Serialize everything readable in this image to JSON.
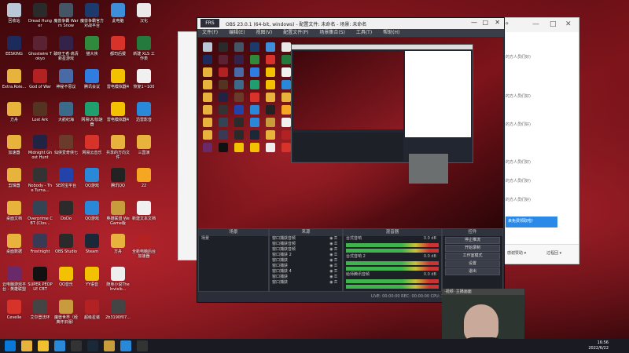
{
  "desktop_icons": [
    {
      "label": "回收站",
      "color": "#b9c7d6",
      "col": 0,
      "row": 0
    },
    {
      "label": "Dread Hunger",
      "color": "#2a2a2a",
      "col": 1,
      "row": 0
    },
    {
      "label": "魔兽争霸 Warm Snow",
      "color": "#445566",
      "col": 2,
      "row": 0
    },
    {
      "label": "魔兽争霸官方对战平台",
      "color": "#1c3a6b",
      "col": 3,
      "row": 0
    },
    {
      "label": "此电脑",
      "color": "#3c8fd8",
      "col": 4,
      "row": 0
    },
    {
      "label": "汉化",
      "color": "#eaeaea",
      "col": 5,
      "row": 0
    },
    {
      "label": "EESKING",
      "color": "#1d2a5c",
      "col": 0,
      "row": 1
    },
    {
      "label": "Ghostwire Tokyo",
      "color": "#5a2233",
      "col": 1,
      "row": 1
    },
    {
      "label": "破晓王者·高清新星游戏",
      "color": "#33224a",
      "col": 2,
      "row": 1
    },
    {
      "label": "猫大侠",
      "color": "#2f8b3b",
      "col": 3,
      "row": 1
    },
    {
      "label": "都司后援",
      "color": "#d8332a",
      "col": 4,
      "row": 1
    },
    {
      "label": "新建 XLS 工作表",
      "color": "#237a3c",
      "col": 5,
      "row": 1
    },
    {
      "label": "Extra.Role...",
      "color": "#e8b33c",
      "col": 0,
      "row": 2
    },
    {
      "label": "God of War",
      "color": "#b22222",
      "col": 1,
      "row": 2
    },
    {
      "label": "神秘不思议",
      "color": "#4a6aa5",
      "col": 2,
      "row": 2
    },
    {
      "label": "腾讯会议",
      "color": "#2f7de1",
      "col": 3,
      "row": 2
    },
    {
      "label": "雷电模拟器4",
      "color": "#f2c200",
      "col": 4,
      "row": 2
    },
    {
      "label": "恢复1~100",
      "color": "#f0f0f0",
      "col": 5,
      "row": 2
    },
    {
      "label": "方舟",
      "color": "#e8b33c",
      "col": 0,
      "row": 3
    },
    {
      "label": "Lost Ark",
      "color": "#553322",
      "col": 1,
      "row": 3
    },
    {
      "label": "大航纪海",
      "color": "#3b6a8a",
      "col": 2,
      "row": 3
    },
    {
      "label": "网易UU加速器",
      "color": "#1f9e6e",
      "col": 3,
      "row": 3
    },
    {
      "label": "雷电模拟器4",
      "color": "#f2c200",
      "col": 4,
      "row": 3
    },
    {
      "label": "迅雷影音",
      "color": "#2a88d8",
      "col": 5,
      "row": 3
    },
    {
      "label": "加速器",
      "color": "#e8b33c",
      "col": 0,
      "row": 4
    },
    {
      "label": "Midnight Ghost Hunt",
      "color": "#222244",
      "col": 1,
      "row": 4
    },
    {
      "label": "仙侠爱奇侠七",
      "color": "#6a3a2a",
      "col": 2,
      "row": 4
    },
    {
      "label": "网易云音乐",
      "color": "#d8332a",
      "col": 3,
      "row": 4
    },
    {
      "label": "共享的方向文件",
      "color": "#e8b33c",
      "col": 4,
      "row": 4
    },
    {
      "label": "三国演",
      "color": "#e8b33c",
      "col": 5,
      "row": 4
    },
    {
      "label": "剪辑器",
      "color": "#e8b33c",
      "col": 0,
      "row": 5
    },
    {
      "label": "Nobody - The Turna...",
      "color": "#333333",
      "col": 1,
      "row": 5
    },
    {
      "label": "SE的宝平台",
      "color": "#2244aa",
      "col": 2,
      "row": 5
    },
    {
      "label": "QQ游戏",
      "color": "#2a88d8",
      "col": 3,
      "row": 5
    },
    {
      "label": "腾讯QQ",
      "color": "#222222",
      "col": 4,
      "row": 5
    },
    {
      "label": "22",
      "color": "#f5a623",
      "col": 5,
      "row": 5
    },
    {
      "label": "桌面文档",
      "color": "#e8b33c",
      "col": 0,
      "row": 6
    },
    {
      "label": "Overprime CBT (Clos...",
      "color": "#334455",
      "col": 1,
      "row": 6
    },
    {
      "label": "DoDo",
      "color": "#2b2b2b",
      "col": 2,
      "row": 6
    },
    {
      "label": "QQ游戏",
      "color": "#2a88d8",
      "col": 3,
      "row": 6
    },
    {
      "label": "英雄联盟 WeGame版",
      "color": "#c89b3c",
      "col": 4,
      "row": 6
    },
    {
      "label": "新建文本文档",
      "color": "#f0f0f0",
      "col": 5,
      "row": 6
    },
    {
      "label": "桌面数据",
      "color": "#e8b33c",
      "col": 0,
      "row": 7
    },
    {
      "label": "Frostnight",
      "color": "#3a3a55",
      "col": 1,
      "row": 7
    },
    {
      "label": "OBS Studio",
      "color": "#2a2a2a",
      "col": 2,
      "row": 7
    },
    {
      "label": "Steam",
      "color": "#1b2838",
      "col": 3,
      "row": 7
    },
    {
      "label": "方舟",
      "color": "#e8b33c",
      "col": 4,
      "row": 7
    },
    {
      "label": "全新电脑后台加速器",
      "color": "#b22222",
      "col": 5,
      "row": 7
    },
    {
      "label": "云电脑游戏平台 - 英雄联盟",
      "color": "#6a2a6a",
      "col": 0,
      "row": 8
    },
    {
      "label": "SUPER PEOPLE CBT",
      "color": "#111111",
      "col": 1,
      "row": 8
    },
    {
      "label": "QQ音乐",
      "color": "#f2c200",
      "col": 2,
      "row": 8
    },
    {
      "label": "YY语音",
      "color": "#f2c200",
      "col": 3,
      "row": 8
    },
    {
      "label": "随身小说The Invisib...",
      "color": "#eeeeee",
      "col": 4,
      "row": 8
    },
    {
      "label": "Cevelle",
      "color": "#d8332a",
      "col": 0,
      "row": 9
    },
    {
      "label": "艾尔登法环",
      "color": "#444444",
      "col": 1,
      "row": 9
    },
    {
      "label": "魔兽世界（经典怀旧服）",
      "color": "#c89b3c",
      "col": 2,
      "row": 9
    },
    {
      "label": "超级星装",
      "color": "#b22222",
      "col": 3,
      "row": 9
    },
    {
      "label": "2b3190f07...",
      "color": "#444444",
      "col": 4,
      "row": 9
    }
  ],
  "chat_window": {
    "controls": [
      "⚬",
      "—",
      "□",
      "✕"
    ],
    "messages": [
      "的方人员们好)",
      "的方人员们好)",
      "的方人员们好)",
      "的方人员们好)",
      "的方人员们好)",
      "的方人员们好)"
    ],
    "highlight": "来免费领取啦!",
    "footer": [
      "感谢赞助 ▾",
      "过程回 ▾"
    ]
  },
  "obs": {
    "title": "OBS 23.0.1 (64-bit, windows) - 配置文件: 未命名 - 场景: 未命名",
    "logo": "FRS",
    "window_controls": [
      "—",
      "□",
      "✕"
    ],
    "menu": [
      "文件(F)",
      "编辑(E)",
      "视图(V)",
      "配置文件(P)",
      "场景集合(S)",
      "工具(T)",
      "帮助(H)"
    ],
    "docks": {
      "scenes": {
        "title": "场景",
        "items": [
          "场景"
        ]
      },
      "sources": {
        "title": "来源",
        "items": [
          "窗口捕获音频",
          "窗口捕获音频",
          "窗口捕获音频",
          "窗口捕获 2",
          "窗口捕获",
          "窗口捕获",
          "窗口捕获 4",
          "窗口捕获",
          "窗口捕获"
        ]
      },
      "mixer": {
        "title": "混音器",
        "channels": [
          {
            "name": "台式音响",
            "db": "0.0 dB"
          },
          {
            "name": "台式音响 2",
            "db": "0.0 dB"
          },
          {
            "name": "给师腾讯音频",
            "db": "0.0 dB"
          }
        ]
      },
      "controls": {
        "title": "控件",
        "buttons": [
          "停止推流",
          "开始录制",
          "工作室模式",
          "设置",
          "退出"
        ]
      }
    },
    "status": "LIVE: 00:00:00   REC: 00:00:00   CPU: 3.4%, 30.00 fps"
  },
  "webcam": {
    "title": "·视频 ·主播画面"
  },
  "taskbar": {
    "time": "16:56",
    "date": "2022/6/22",
    "apps": [
      "start",
      "folder",
      "chrome",
      "ie",
      "obs",
      "steam",
      "game",
      "tencent",
      "obs2"
    ]
  }
}
